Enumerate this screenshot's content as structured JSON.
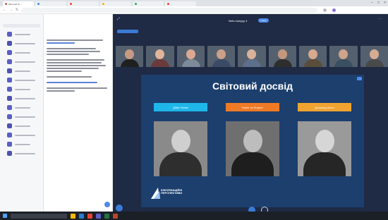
{
  "browser": {
    "tabs": [
      {
        "label": "Microsoft Te...",
        "active": true
      },
      {
        "label": "",
        "active": false
      },
      {
        "label": "",
        "active": false
      },
      {
        "label": "",
        "active": false
      },
      {
        "label": "",
        "active": false
      },
      {
        "label": "",
        "active": false
      }
    ],
    "url": ""
  },
  "meeting": {
    "title": "Nehu kanyyy 4",
    "pill": "Leave",
    "participants": [
      {
        "skin": "#c69a83",
        "shirt": "#1f1f1f"
      },
      {
        "skin": "#e0b59a",
        "shirt": "#6b3b3b"
      },
      {
        "skin": "#d8a990",
        "shirt": "#7c8a99"
      },
      {
        "skin": "#caa088",
        "shirt": "#3b4a66"
      },
      {
        "skin": "#d9b19a",
        "shirt": "#5e6f8a"
      },
      {
        "skin": "#c4977c",
        "shirt": "#2e2e2e"
      },
      {
        "skin": "#d7a98e",
        "shirt": "#5a4d3a"
      },
      {
        "skin": "#cfa48a",
        "shirt": "#3a4f5f"
      },
      {
        "skin": "#d6ac93",
        "shirt": "#4a4a4a"
      }
    ]
  },
  "slide": {
    "title": "Світовий досвід",
    "labels": [
      {
        "text": "Дібріт Кевін",
        "color": "#1fb6ea"
      },
      {
        "text": "Бонні та Форшіт",
        "color": "#ef7a25"
      },
      {
        "text": "Дональд Шьон",
        "color": "#f0a330"
      }
    ],
    "logo_text_1": "ІНФОРМАЦІЙНІ",
    "logo_text_2": "ПЕРСПЕКТИВИ"
  },
  "chat": {
    "pane_title": "",
    "items_count": 14
  },
  "taskbar": {
    "search_placeholder": "",
    "clock": ""
  },
  "colors": {
    "stage_bg": "#1f2a44",
    "slide_bg": "#1c3f6e",
    "accent": "#4f8be6",
    "teams_purple": "#5b5fc7"
  }
}
